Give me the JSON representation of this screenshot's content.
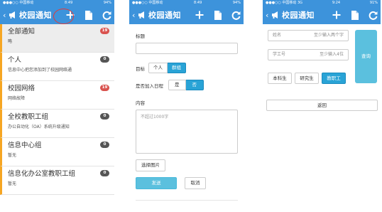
{
  "status_left": "●●●○○ 中国移动",
  "screen1": {
    "status_time": "8:49",
    "status_battery": "94%",
    "nav_title": "校园通知",
    "items": [
      {
        "title": "全部通知",
        "subtitle": "略",
        "badge": "19",
        "badge_color": "red"
      },
      {
        "title": "个人",
        "subtitle": "信息中心把您添加到了校园网络通",
        "badge": "0",
        "badge_color": "gray"
      },
      {
        "title": "校园网络",
        "subtitle": "网络故障",
        "badge": "19",
        "badge_color": "red"
      },
      {
        "title": "全校教职工组",
        "subtitle": "办公自动化（OA）系统升级通知",
        "badge": "0",
        "badge_color": "gray"
      },
      {
        "title": "信息中心组",
        "subtitle": "暂无",
        "badge": "0",
        "badge_color": "gray"
      },
      {
        "title": "信息化办公室教职工组",
        "subtitle": "暂无",
        "badge": "0",
        "badge_color": "gray"
      }
    ]
  },
  "screen2": {
    "status_time": "8:49",
    "status_battery": "94%",
    "nav_title": "校园通知",
    "title_label": "标题",
    "target_label": "目标",
    "target_options": [
      "个人",
      "群组"
    ],
    "schedule_label": "是否加入日程",
    "schedule_options": [
      "是",
      "否"
    ],
    "content_label": "内容",
    "content_placeholder": "不超过1000字",
    "choose_image_label": "选择图片",
    "send_label": "发送",
    "cancel_label": "取消"
  },
  "screen3": {
    "status_left": "●●●○○ 中国移动  3G",
    "status_time": "9:24",
    "status_battery": "91%",
    "nav_title": "校园通知",
    "name_label": "姓名",
    "name_hint": "至少输入两个字",
    "id_label": "学工号",
    "id_hint": "至少输入4位",
    "search_label": "查询",
    "roles": [
      "本科生",
      "研究生",
      "教职工"
    ],
    "back_label": "返回"
  },
  "colors": {
    "nav": "#3d93db",
    "accent": "#29a3d6",
    "badge_red": "#d9534f",
    "highlight_ring": "#e53935"
  }
}
